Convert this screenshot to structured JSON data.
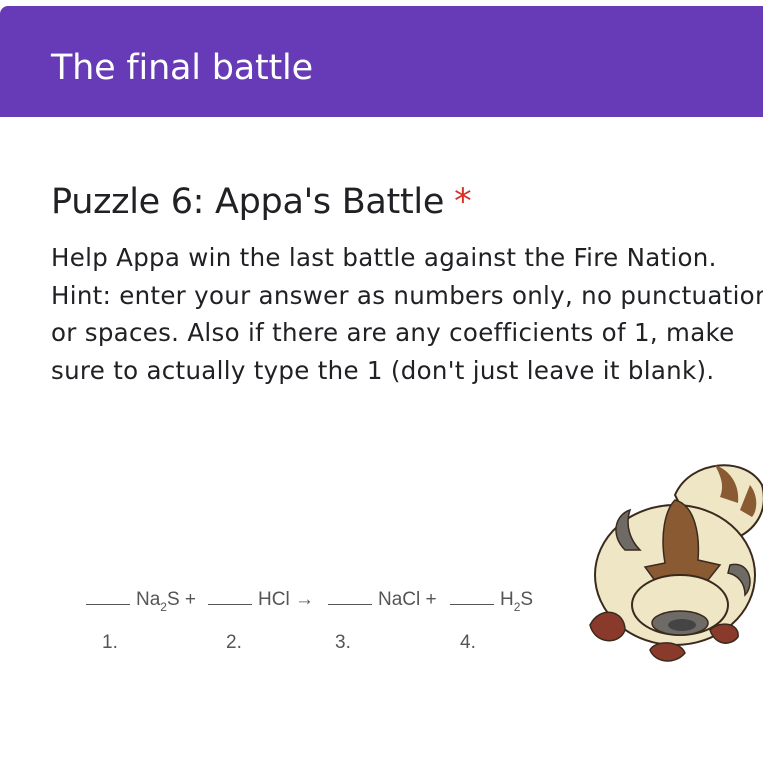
{
  "header": {
    "title": "The final battle"
  },
  "question": {
    "title": "Puzzle 6: Appa's Battle",
    "required_marker": "*",
    "description_lines": [
      "Help Appa win the last battle against the Fire Nation.",
      "Hint: enter your answer as numbers only, no punctuation",
      "or spaces. Also if there are any coefficients of 1, make",
      "sure to actually type the 1 (don't just leave it blank)."
    ]
  },
  "equation": {
    "term1": {
      "main": "Na",
      "sub": "2",
      "tail": "S +"
    },
    "term2": {
      "main": "HCl →"
    },
    "term3": {
      "main": "NaCl +"
    },
    "term4": {
      "main": "H",
      "sub": "2",
      "tail": "S"
    },
    "numbers": [
      "1.",
      "2.",
      "3.",
      "4."
    ]
  },
  "colors": {
    "header": "#673ab7",
    "required": "#d93025"
  },
  "image": {
    "icon": "appa-bison-illustration"
  }
}
